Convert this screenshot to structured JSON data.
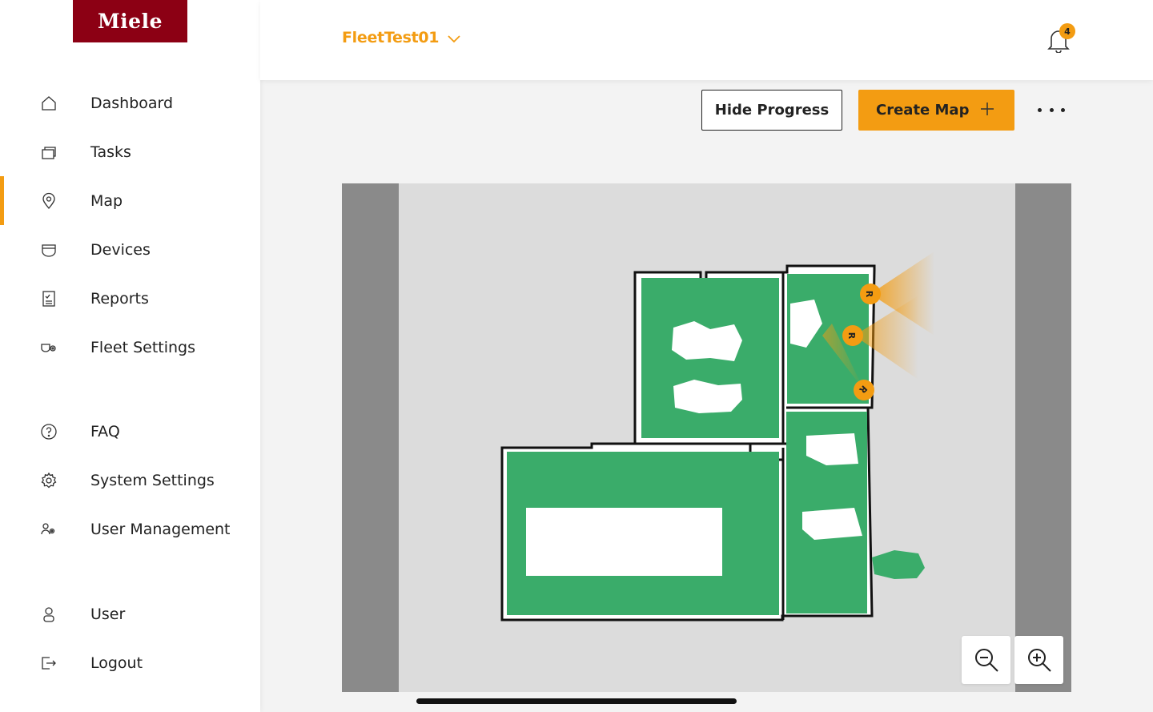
{
  "brand": {
    "logo_text": "Miele",
    "logo_color": "#8c0014",
    "accent_color": "#f39c12"
  },
  "sidebar": {
    "items": [
      {
        "label": "Dashboard",
        "icon": "home-icon",
        "active": false
      },
      {
        "label": "Tasks",
        "icon": "tasks-icon",
        "active": false
      },
      {
        "label": "Map",
        "icon": "map-pin-icon",
        "active": true
      },
      {
        "label": "Devices",
        "icon": "device-icon",
        "active": false
      },
      {
        "label": "Reports",
        "icon": "report-icon",
        "active": false
      },
      {
        "label": "Fleet Settings",
        "icon": "fleet-settings-icon",
        "active": false
      },
      {
        "label": "FAQ",
        "icon": "help-icon",
        "active": false
      },
      {
        "label": "System Settings",
        "icon": "gear-icon",
        "active": false
      },
      {
        "label": "User Management",
        "icon": "users-icon",
        "active": false
      },
      {
        "label": "User",
        "icon": "user-icon",
        "active": false
      },
      {
        "label": "Logout",
        "icon": "logout-icon",
        "active": false
      }
    ]
  },
  "header": {
    "fleet_name": "FleetTest01",
    "notification_count": "4"
  },
  "toolbar": {
    "hide_progress_label": "Hide Progress",
    "create_map_label": "Create Map"
  },
  "map": {
    "robot_label": "R",
    "robot_count": 3,
    "covered_color": "#3aac6a",
    "background_color": "#dcdcdc"
  }
}
